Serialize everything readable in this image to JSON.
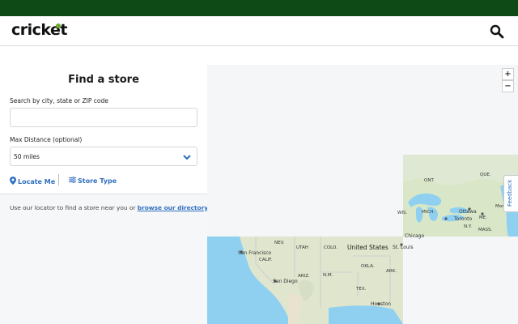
{
  "header": {
    "logo_text": "cricket",
    "search_icon": "search-icon"
  },
  "panel": {
    "title": "Find a store",
    "search_label": "Search by city, state or ZIP code",
    "search_value": "",
    "distance_label": "Max Distance (optional)",
    "distance_value": "50 miles",
    "locate_label": "Locate Me",
    "store_type_label": "Store Type",
    "help_text": "Use our locator to find a store near you or ",
    "help_link": "browse our directory."
  },
  "map": {
    "zoom_in": "+",
    "zoom_out": "−",
    "feedback_label": "Feedback",
    "labels": {
      "ont": "ONT.",
      "que": "QUE.",
      "wis": "WIS.",
      "mich": "MICH.",
      "ottawa": "Ottawa",
      "montreal": "Montr",
      "toronto": "Toronto",
      "me": "ME.",
      "ny": "N.Y.",
      "mass": "MASS.",
      "chicago": "Chicago",
      "nev": "NEV.",
      "utah": "UTAH",
      "colo": "COLO.",
      "united_states": "United States",
      "st_louis": "St. Louis",
      "san_francisco": "San Francisco",
      "calif": "CALIF.",
      "okla": "OKLA.",
      "ark": "ARK.",
      "ariz": "ARIZ.",
      "nm": "N.M.",
      "san_diego": "San Diego",
      "tex": "TEX.",
      "houston": "Houston"
    }
  },
  "colors": {
    "topbar": "#0e4a16",
    "link": "#2e6fbf",
    "water": "#8fd0f0",
    "land": "#e9e4dc",
    "land_green": "#d4e6c2"
  }
}
